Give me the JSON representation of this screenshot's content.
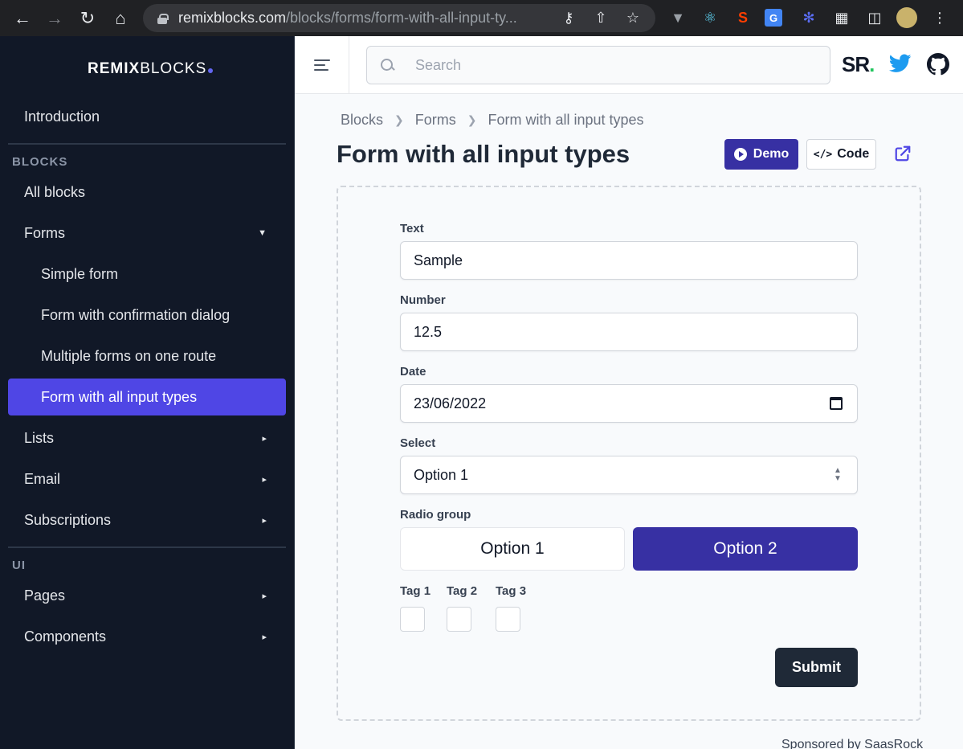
{
  "browser": {
    "url_host": "remixblocks.com",
    "url_path": "/blocks/forms/form-with-all-input-ty..."
  },
  "sidebar": {
    "logo_bold": "REMIX",
    "logo_light": "BLOCKS",
    "intro": "Introduction",
    "blocks_heading": "BLOCKS",
    "all_blocks": "All blocks",
    "forms": "Forms",
    "forms_sub": [
      "Simple form",
      "Form with confirmation dialog",
      "Multiple forms on one route",
      "Form with all input types"
    ],
    "lists": "Lists",
    "email": "Email",
    "subscriptions": "Subscriptions",
    "ui_heading": "UI",
    "pages": "Pages",
    "components": "Components"
  },
  "topbar": {
    "search_placeholder": "Search",
    "sr_logo": "SR",
    "sr_dot": "."
  },
  "breadcrumb": [
    "Blocks",
    "Forms",
    "Form with all input types"
  ],
  "page": {
    "title": "Form with all input types",
    "demo_label": "Demo",
    "code_label": "Code"
  },
  "form": {
    "text_label": "Text",
    "text_value": "Sample",
    "number_label": "Number",
    "number_value": "12.5",
    "date_label": "Date",
    "date_value": "23/06/2022",
    "select_label": "Select",
    "select_value": "Option 1",
    "radio_label": "Radio group",
    "radio_options": [
      "Option 1",
      "Option 2"
    ],
    "tags": [
      "Tag 1",
      "Tag 2",
      "Tag 3"
    ],
    "submit_label": "Submit"
  },
  "sponsor": "Sponsored by SaasRock",
  "colors": {
    "sidebar_bg": "#111827",
    "accent": "#4f46e5",
    "primary_button": "#3730a3",
    "submit_button": "#1f2937"
  }
}
